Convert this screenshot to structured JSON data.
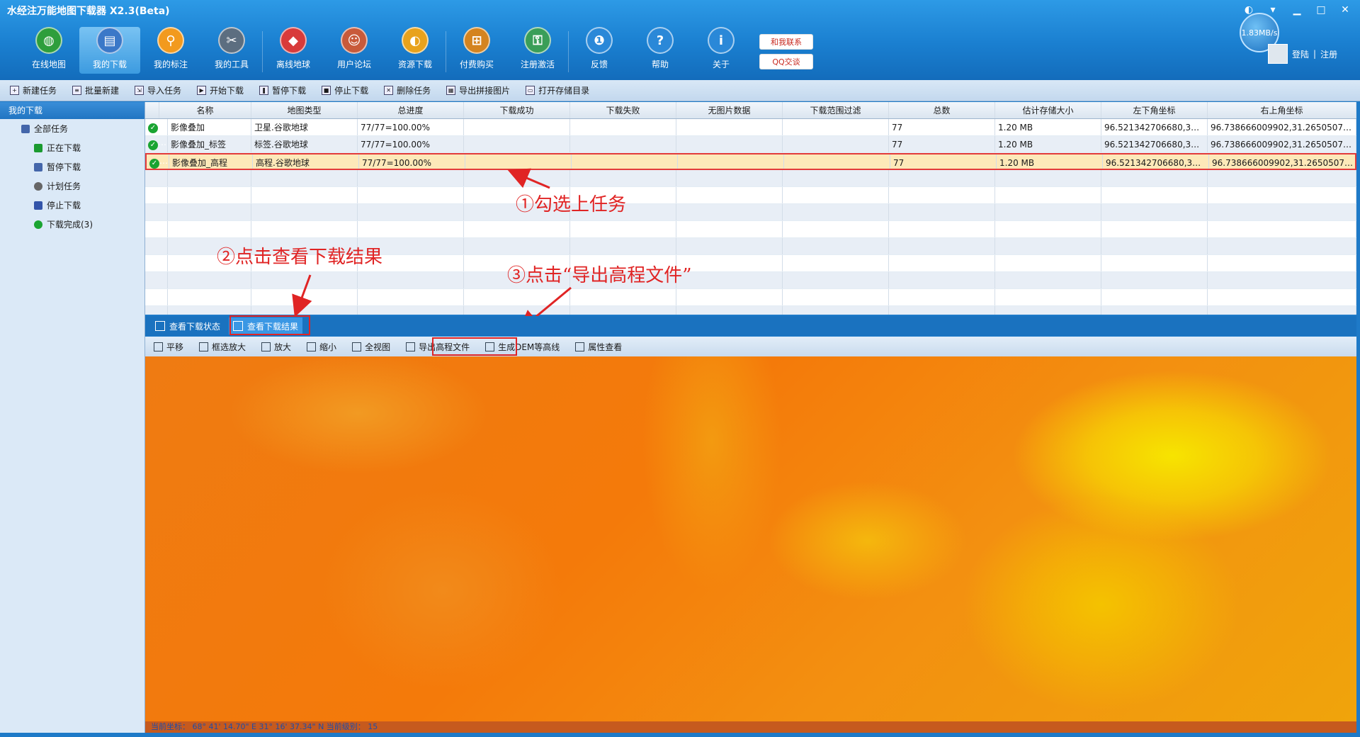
{
  "window": {
    "title": "水经注万能地图下载器 X2.3(Beta)"
  },
  "toolbar": [
    {
      "label": "在线地图",
      "icon": "globe-icon",
      "color": "#2e9e3c"
    },
    {
      "label": "我的下载",
      "icon": "download-list-icon",
      "color": "#3b78c8"
    },
    {
      "label": "我的标注",
      "icon": "map-pin-icon",
      "color": "#f29a1e"
    },
    {
      "label": "我的工具",
      "icon": "tools-icon",
      "color": "#5c6e80"
    },
    {
      "label": "离线地球",
      "icon": "cubes-icon",
      "color": "#d83b3b"
    },
    {
      "label": "用户论坛",
      "icon": "users-icon",
      "color": "#c85a3a"
    },
    {
      "label": "资源下载",
      "icon": "resource-globe-icon",
      "color": "#e8a21c"
    },
    {
      "label": "付费购买",
      "icon": "cart-icon",
      "color": "#d48420"
    },
    {
      "label": "注册激活",
      "icon": "lock-globe-icon",
      "color": "#3a9e58"
    },
    {
      "label": "反馈",
      "icon": "feedback-icon",
      "color": "#2a88d8"
    },
    {
      "label": "帮助",
      "icon": "help-icon",
      "color": "#2a88d8"
    },
    {
      "label": "关于",
      "icon": "info-icon",
      "color": "#2a88d8"
    }
  ],
  "promo": {
    "contact": "和我联系",
    "qq": "QQ交谈"
  },
  "speed": "1.83MB/s",
  "auth": {
    "login": "登陆",
    "sep": "|",
    "register": "注册"
  },
  "actions": [
    "新建任务",
    "批量新建",
    "导入任务",
    "开始下载",
    "暂停下载",
    "停止下载",
    "删除任务",
    "导出拼接图片",
    "打开存储目录"
  ],
  "sidebar": {
    "title": "我的下载",
    "items": [
      {
        "label": "全部任务",
        "icon": "all-tasks-icon"
      },
      {
        "label": "正在下载",
        "icon": "play-icon"
      },
      {
        "label": "暂停下载",
        "icon": "pause-icon"
      },
      {
        "label": "计划任务",
        "icon": "clock-icon"
      },
      {
        "label": "停止下载",
        "icon": "stop-icon"
      },
      {
        "label": "下载完成(3)",
        "icon": "check-icon"
      }
    ]
  },
  "table": {
    "headers": [
      "",
      "名称",
      "地图类型",
      "总进度",
      "下载成功",
      "下载失败",
      "无图片数据",
      "下载范围过滤",
      "总数",
      "估计存储大小",
      "左下角坐标",
      "右上角坐标"
    ],
    "rows": [
      {
        "checked": false,
        "name": "影像叠加",
        "type": "卫星.谷歌地球",
        "progress": "77/77=100.00%",
        "success": "",
        "fail": "",
        "nodata": "",
        "filter": "",
        "total": "77",
        "size": "1.20 MB",
        "lb": "96.521342706680,31.1...",
        "rt": "96.738666009902,31.2650507688..."
      },
      {
        "checked": false,
        "name": "影像叠加_标签",
        "type": "标签.谷歌地球",
        "progress": "77/77=100.00%",
        "success": "",
        "fail": "",
        "nodata": "",
        "filter": "",
        "total": "77",
        "size": "1.20 MB",
        "lb": "96.521342706680,31.1...",
        "rt": "96.738666009902,31.2650507688..."
      },
      {
        "checked": true,
        "name": "影像叠加_高程",
        "type": "高程.谷歌地球",
        "progress": "77/77=100.00%",
        "success": "",
        "fail": "",
        "nodata": "",
        "filter": "",
        "total": "77",
        "size": "1.20 MB",
        "lb": "96.521342706680,31.1...",
        "rt": "96.738666009902,31.2650507688..."
      }
    ]
  },
  "annotations": {
    "a1": "①勾选上任务",
    "a2": "②点击查看下载结果",
    "a3": "③点击“导出高程文件”"
  },
  "bottom_tabs": [
    "查看下载状态",
    "查看下载结果"
  ],
  "map_tools": [
    "平移",
    "框选放大",
    "放大",
    "缩小",
    "全视图",
    "导出高程文件",
    "生成DEM等高线",
    "属性查看"
  ],
  "status": {
    "label": "当前坐标：",
    "coords": "68° 41' 14.70\" E 31° 16' 37.34\" N",
    "level_label": "当前级别：",
    "level": "15"
  }
}
